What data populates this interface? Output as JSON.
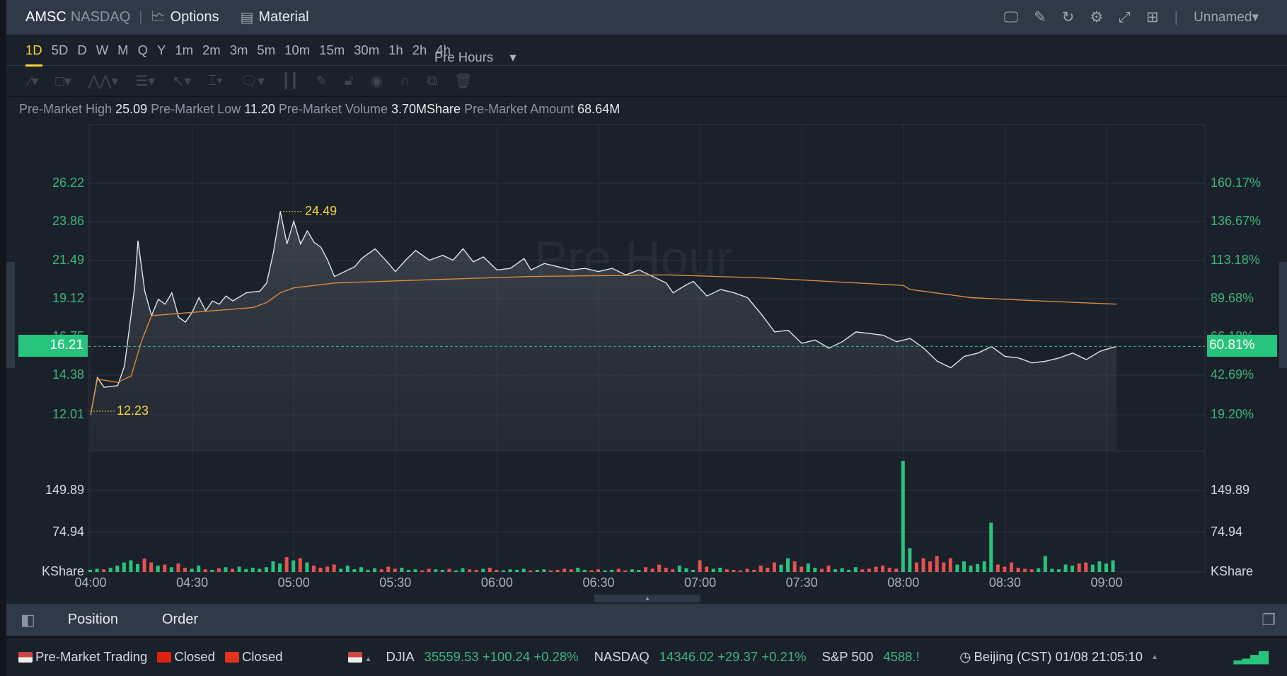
{
  "header": {
    "symbol": "AMSC",
    "exchange": "NASDAQ",
    "options_label": "Options",
    "material_label": "Material",
    "layout_name": "Unnamed"
  },
  "timeframes": [
    "1D",
    "5D",
    "D",
    "W",
    "M",
    "Q",
    "Y",
    "1m",
    "2m",
    "3m",
    "5m",
    "10m",
    "15m",
    "30m",
    "1h",
    "2h",
    "4h"
  ],
  "active_timeframe": "1D",
  "session_select": "Pre Hours",
  "info": {
    "high_label": "Pre-Market High",
    "high": "25.09",
    "low_label": "Pre-Market Low",
    "low": "11.20",
    "vol_label": "Pre-Market Volume",
    "vol": "3.70MShare",
    "amt_label": "Pre-Market Amount",
    "amt": "68.64M"
  },
  "watermark": "Pre Hour",
  "chart_data": {
    "type": "line",
    "title": "AMSC Pre-Market intraday",
    "x_labels": [
      "04:00",
      "04:30",
      "05:00",
      "05:30",
      "06:00",
      "06:30",
      "07:00",
      "07:30",
      "08:00",
      "08:30",
      "09:00"
    ],
    "price_ticks": [
      "26.22",
      "23.86",
      "21.49",
      "19.12",
      "16.75",
      "14.38",
      "12.01"
    ],
    "pct_ticks": [
      "160.17%",
      "136.67%",
      "113.18%",
      "89.68%",
      "66.18%",
      "42.69%",
      "19.20%"
    ],
    "volume_ticks": [
      "149.89",
      "74.94",
      "KShare"
    ],
    "volume_unit": "KShare",
    "ylim": [
      12.01,
      26.22
    ],
    "current_price": "16.21",
    "current_pct": "60.81%",
    "current_value": 16.21,
    "high_marker": "24.49",
    "high_value": 24.49,
    "high_minute": 56,
    "low_marker": "12.23",
    "low_value": 12.23,
    "low_minute": 0,
    "price_minutes": [
      0,
      2,
      4,
      8,
      10,
      13,
      14,
      16,
      18,
      20,
      22,
      24,
      26,
      28,
      30,
      32,
      34,
      36,
      38,
      40,
      42,
      46,
      50,
      52,
      54,
      56,
      58,
      60,
      62,
      64,
      66,
      68,
      70,
      72,
      75,
      78,
      80,
      84,
      88,
      90,
      93,
      96,
      100,
      104,
      107,
      110,
      113,
      116,
      120,
      124,
      128,
      130,
      134,
      138,
      142,
      146,
      150,
      154,
      158,
      162,
      166,
      170,
      172,
      176,
      178,
      182,
      186,
      190,
      194,
      198,
      202,
      206,
      210,
      214,
      218,
      222,
      226,
      230,
      234,
      238,
      242,
      246,
      250,
      254,
      258,
      262,
      266,
      270,
      274,
      278,
      282,
      286,
      290,
      294,
      298,
      301,
      303
    ],
    "price_values": [
      12.0,
      14.3,
      13.7,
      13.8,
      15.0,
      19.8,
      22.7,
      19.6,
      18.1,
      19.1,
      18.8,
      19.5,
      18.0,
      17.7,
      18.3,
      19.2,
      18.4,
      19.0,
      18.8,
      19.3,
      19.0,
      19.5,
      19.6,
      20.1,
      22.0,
      24.49,
      22.5,
      23.9,
      22.5,
      23.3,
      22.6,
      22.3,
      21.5,
      20.5,
      20.8,
      21.1,
      21.6,
      22.2,
      21.3,
      20.8,
      21.5,
      22.1,
      21.5,
      21.8,
      21.5,
      22.2,
      21.4,
      21.7,
      20.9,
      21.0,
      21.6,
      20.9,
      21.3,
      21.1,
      20.9,
      21.0,
      20.8,
      21.0,
      20.6,
      20.9,
      20.5,
      20.1,
      19.5,
      20.0,
      20.2,
      19.3,
      19.7,
      19.5,
      19.2,
      18.2,
      17.1,
      17.2,
      16.4,
      16.6,
      16.1,
      16.5,
      17.1,
      17.0,
      16.9,
      16.5,
      16.7,
      16.1,
      15.3,
      14.9,
      15.6,
      15.8,
      16.2,
      15.6,
      15.5,
      15.2,
      15.3,
      15.5,
      15.8,
      15.4,
      15.9,
      16.1,
      16.21
    ],
    "avg_minutes": [
      0,
      2,
      8,
      12,
      15,
      18,
      30,
      48,
      52,
      56,
      60,
      72,
      100,
      130,
      170,
      200,
      240,
      242,
      260,
      280,
      303
    ],
    "avg_values": [
      12.0,
      14.2,
      14.0,
      14.4,
      16.5,
      18.1,
      18.3,
      18.6,
      18.9,
      19.5,
      19.8,
      20.1,
      20.3,
      20.5,
      20.6,
      20.4,
      19.95,
      19.7,
      19.2,
      19.0,
      18.8
    ],
    "volume_interval_min": 2,
    "volume_values": [
      4,
      6,
      5,
      8,
      12,
      18,
      22,
      15,
      25,
      18,
      12,
      14,
      9,
      16,
      8,
      6,
      12,
      5,
      4,
      7,
      9,
      6,
      10,
      5,
      8,
      6,
      9,
      20,
      16,
      28,
      22,
      26,
      18,
      12,
      8,
      10,
      14,
      6,
      12,
      5,
      9,
      4,
      7,
      5,
      10,
      6,
      8,
      4,
      5,
      3,
      6,
      5,
      4,
      6,
      3,
      7,
      5,
      4,
      6,
      8,
      4,
      3,
      5,
      4,
      6,
      3,
      4,
      5,
      3,
      4,
      6,
      5,
      8,
      4,
      3,
      5,
      3,
      4,
      6,
      3,
      5,
      4,
      9,
      6,
      14,
      8,
      5,
      12,
      7,
      4,
      22,
      10,
      6,
      8,
      5,
      4,
      3,
      6,
      4,
      12,
      8,
      18,
      14,
      26,
      20,
      10,
      16,
      8,
      6,
      12,
      5,
      7,
      4,
      9,
      5,
      6,
      10,
      12,
      8,
      6,
      210,
      45,
      18,
      26,
      20,
      30,
      18,
      26,
      14,
      20,
      12,
      15,
      20,
      93,
      14,
      10,
      18,
      8,
      6,
      5,
      7,
      30,
      6,
      5,
      14,
      12,
      16,
      18,
      14,
      20,
      16,
      22
    ]
  },
  "colors": {
    "up": "#27c47d",
    "down": "#e5524f",
    "price_line": "#dfe3e8",
    "avg_line": "#d98a3e",
    "marker": "#f3d33b"
  },
  "bottom_tabs": {
    "position": "Position",
    "order": "Order"
  },
  "status": {
    "us_market": "Pre-Market Trading",
    "hk": "Closed",
    "cn": "Closed",
    "djia_label": "DJIA",
    "djia": "35559.53 +100.24 +0.28%",
    "nasdaq_label": "NASDAQ",
    "nasdaq": "14346.02 +29.37 +0.21%",
    "sp_label": "S&P 500",
    "sp": "4588.!",
    "clock": "Beijing (CST) 01/08 21:05:10"
  }
}
